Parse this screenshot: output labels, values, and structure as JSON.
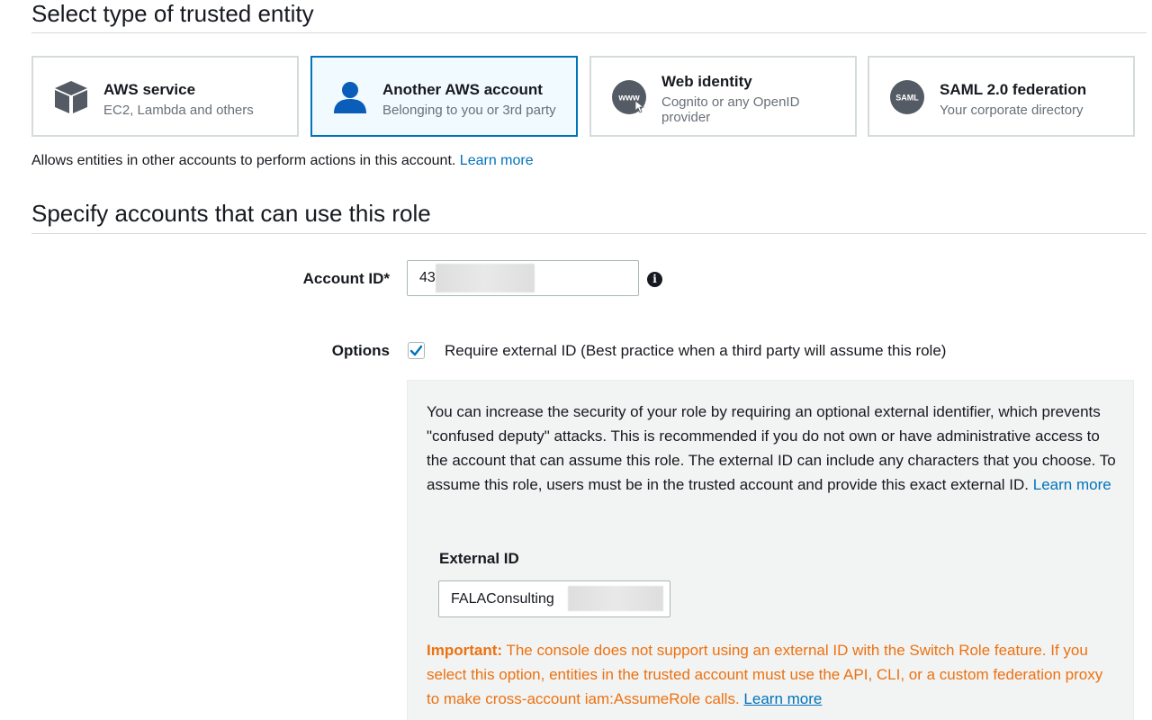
{
  "trusted_entity": {
    "title": "Select type of trusted entity",
    "cards": [
      {
        "id": "aws-service",
        "title": "AWS service",
        "subtitle": "EC2, Lambda and others",
        "icon": "cube-icon",
        "selected": false
      },
      {
        "id": "another-account",
        "title": "Another AWS account",
        "subtitle": "Belonging to you or 3rd party",
        "icon": "user-icon",
        "selected": true
      },
      {
        "id": "web-identity",
        "title": "Web identity",
        "subtitle": "Cognito or any OpenID provider",
        "subtitle_line1": "Cognito or any OpenID",
        "subtitle_line2": "provider",
        "icon": "www-icon",
        "icon_text": "www",
        "selected": false
      },
      {
        "id": "saml",
        "title": "SAML 2.0 federation",
        "subtitle": "Your corporate directory",
        "icon": "saml-icon",
        "icon_text": "SAML",
        "selected": false
      }
    ],
    "description": "Allows entities in other accounts to perform actions in this account.",
    "learn_more": "Learn more"
  },
  "specify_accounts": {
    "title": "Specify accounts that can use this role",
    "account_id_label": "Account ID*",
    "account_id_value": "43",
    "options_label": "Options",
    "require_external_id_checked": true,
    "require_external_id_label": "Require external ID (Best practice when a third party will assume this role)"
  },
  "external_id_panel": {
    "description": "You can increase the security of your role by requiring an optional external identifier, which prevents \"confused deputy\" attacks. This is recommended if you do not own or have administrative access to the account that can assume this role. The external ID can include any characters that you choose. To assume this role, users must be in the trusted account and provide this exact external ID.",
    "learn_more": "Learn more",
    "external_id_label": "External ID",
    "external_id_value": "FALAConsulting",
    "important_label": "Important:",
    "important_text": "The console does not support using an external ID with the Switch Role feature. If you select this option, entities in the trusted account must use the API, CLI, or a custom federation proxy to make cross-account iam:AssumeRole calls.",
    "important_learn_more": "Learn more"
  },
  "colors": {
    "link": "#0073bb",
    "selected_border": "#0073bb",
    "selected_bg": "#f1faff",
    "warning": "#ec7211",
    "panel_bg": "#f2f3f3"
  }
}
